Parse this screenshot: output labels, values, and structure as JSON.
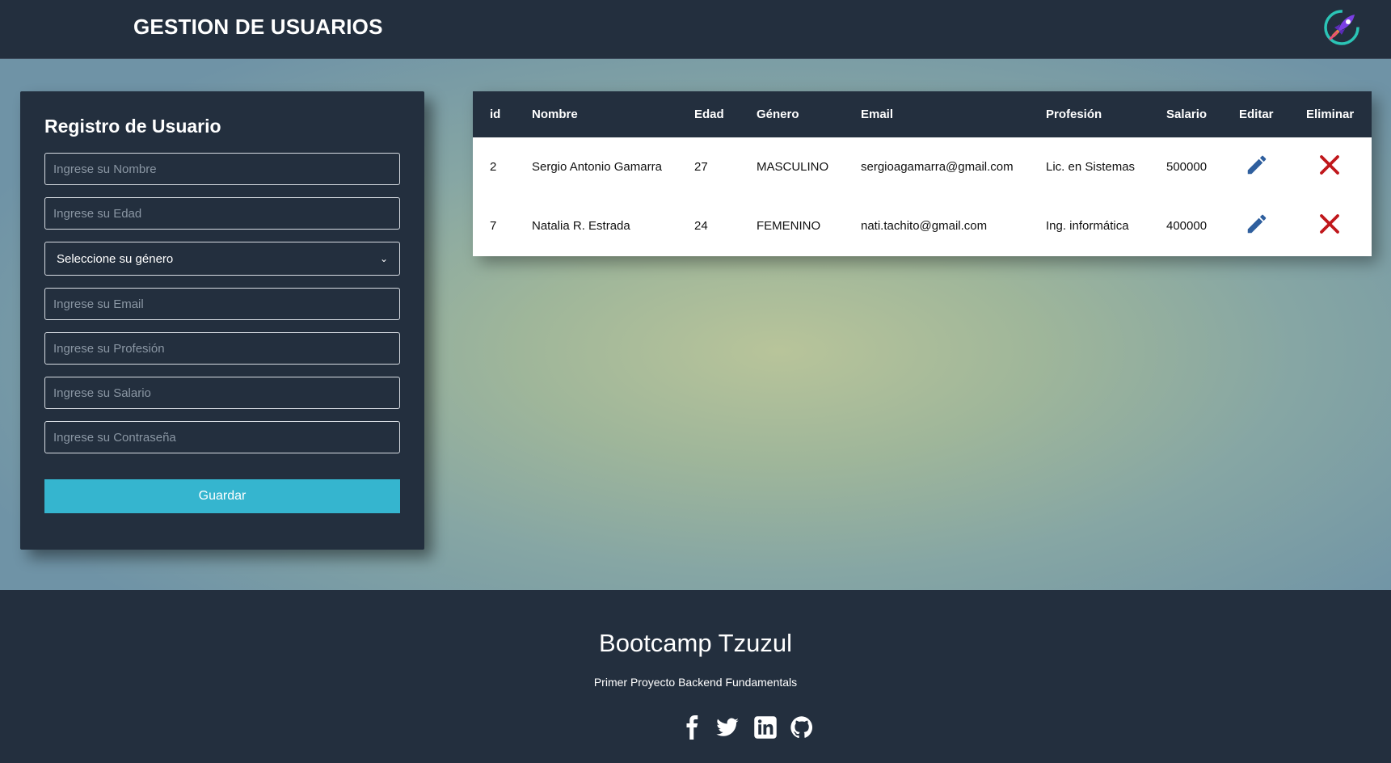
{
  "header": {
    "title": "GESTION DE USUARIOS",
    "logo_icon": "rocket-logo-icon"
  },
  "form": {
    "title": "Registro de Usuario",
    "nombre_placeholder": "Ingrese su Nombre",
    "edad_placeholder": "Ingrese su Edad",
    "genero_selected": "Seleccione su género",
    "email_placeholder": "Ingrese su Email",
    "profesion_placeholder": "Ingrese su Profesión",
    "salario_placeholder": "Ingrese su Salario",
    "password_placeholder": "Ingrese su Contraseña",
    "save_label": "Guardar"
  },
  "table": {
    "headers": [
      "id",
      "Nombre",
      "Edad",
      "Género",
      "Email",
      "Profesión",
      "Salario",
      "Editar",
      "Eliminar"
    ],
    "rows": [
      {
        "id": "2",
        "nombre": "Sergio Antonio Gamarra",
        "edad": "27",
        "genero": "MASCULINO",
        "email": "sergioagamarra@gmail.com",
        "profesion": "Lic. en Sistemas",
        "salario": "500000"
      },
      {
        "id": "7",
        "nombre": "Natalia R. Estrada",
        "edad": "24",
        "genero": "FEMENINO",
        "email": "nati.tachito@gmail.com",
        "profesion": "Ing. informática",
        "salario": "400000"
      }
    ],
    "edit_icon": "pencil-icon",
    "delete_icon": "close-x-icon"
  },
  "footer": {
    "title": "Bootcamp Tzuzul",
    "subtitle": "Primer Proyecto Backend Fundamentals",
    "social_icons": [
      "facebook-icon",
      "twitter-icon",
      "linkedin-icon",
      "github-icon"
    ]
  },
  "colors": {
    "dark_bg": "#232f3e",
    "accent_button": "#35b5cf",
    "edit_blue": "#2f5f9e",
    "delete_red": "#c0171b"
  }
}
